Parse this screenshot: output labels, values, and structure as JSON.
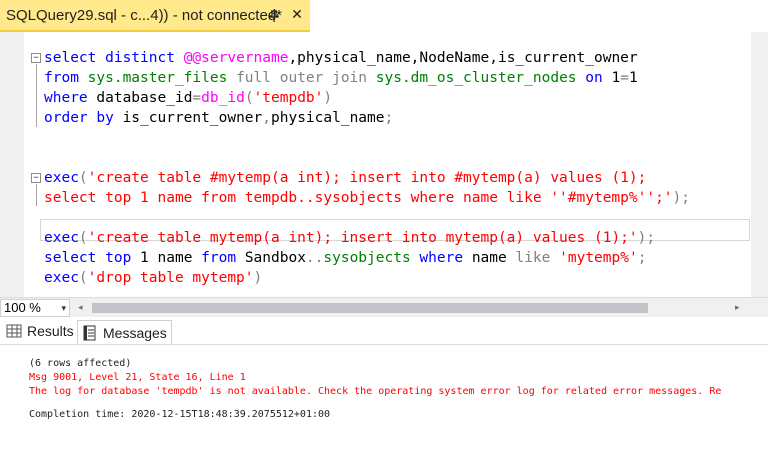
{
  "tab": {
    "title": "SQLQuery29.sql - c...4)) - not connected*",
    "close_glyph": "✕",
    "pin_icon": "pin-icon"
  },
  "editor": {
    "lines": [
      [
        {
          "t": "select distinct ",
          "c": "kw"
        },
        {
          "t": "@@servername",
          "c": "fn"
        },
        {
          "t": ",physical_name,NodeName,is_current_owner",
          "c": ""
        }
      ],
      [
        {
          "t": "from ",
          "c": "kw"
        },
        {
          "t": "sys.master_files ",
          "c": "sys"
        },
        {
          "t": "full outer join ",
          "c": "gry"
        },
        {
          "t": "sys.dm_os_cluster_nodes ",
          "c": "sys"
        },
        {
          "t": "on ",
          "c": "kw"
        },
        {
          "t": "1",
          "c": ""
        },
        {
          "t": "=",
          "c": "gry"
        },
        {
          "t": "1",
          "c": ""
        }
      ],
      [
        {
          "t": "where ",
          "c": "kw"
        },
        {
          "t": "database_id",
          "c": ""
        },
        {
          "t": "=",
          "c": "gry"
        },
        {
          "t": "db_id",
          "c": "fn"
        },
        {
          "t": "(",
          "c": "gry"
        },
        {
          "t": "'tempdb'",
          "c": "str"
        },
        {
          "t": ")",
          "c": "gry"
        }
      ],
      [
        {
          "t": "order by ",
          "c": "kw"
        },
        {
          "t": "is_current_owner",
          "c": ""
        },
        {
          "t": ",",
          "c": "gry"
        },
        {
          "t": "physical_name",
          "c": ""
        },
        {
          "t": ";",
          "c": "gry"
        }
      ],
      [],
      [],
      [
        {
          "t": "exec",
          "c": "kw"
        },
        {
          "t": "(",
          "c": "gry"
        },
        {
          "t": "'create table #mytemp(a int); insert into #mytemp(a) values (1);",
          "c": "str"
        }
      ],
      [
        {
          "t": "select top 1 name from tempdb..sysobjects where name like ''#mytemp%'';'",
          "c": "str"
        },
        {
          "t": ");",
          "c": "gry"
        }
      ],
      [],
      [
        {
          "t": "exec",
          "c": "kw"
        },
        {
          "t": "(",
          "c": "gry"
        },
        {
          "t": "'create table mytemp(a int); insert into mytemp(a) values (1);'",
          "c": "str"
        },
        {
          "t": ");",
          "c": "gry"
        }
      ],
      [
        {
          "t": "select top ",
          "c": "kw"
        },
        {
          "t": "1 ",
          "c": ""
        },
        {
          "t": "name ",
          "c": ""
        },
        {
          "t": "from ",
          "c": "kw"
        },
        {
          "t": "Sandbox",
          "c": ""
        },
        {
          "t": "..",
          "c": "gry"
        },
        {
          "t": "sysobjects ",
          "c": "sys"
        },
        {
          "t": "where ",
          "c": "kw"
        },
        {
          "t": "name ",
          "c": ""
        },
        {
          "t": "like ",
          "c": "gry"
        },
        {
          "t": "'mytemp%'",
          "c": "str"
        },
        {
          "t": ";",
          "c": "gry"
        }
      ],
      [
        {
          "t": "exec",
          "c": "kw"
        },
        {
          "t": "(",
          "c": "gry"
        },
        {
          "t": "'drop table mytemp'",
          "c": "str"
        },
        {
          "t": ")",
          "c": "gry"
        }
      ]
    ]
  },
  "zoom": {
    "value": "100 %",
    "arrow": "▾"
  },
  "scroll": {
    "left_arrow": "◂",
    "right_arrow": "▸"
  },
  "result_tabs": {
    "results": "Results",
    "messages": "Messages"
  },
  "messages": {
    "lines": [
      {
        "text": "(6 rows affected)",
        "error": false
      },
      {
        "text": "Msg 9001, Level 21, State 16, Line 1",
        "error": true
      },
      {
        "text": "The log for database 'tempdb' is not available. Check the operating system error log for related error messages. Re",
        "error": true
      },
      {
        "text": "",
        "error": false
      },
      {
        "text": "Completion time: 2020-12-15T18:48:39.2075512+01:00",
        "error": false
      }
    ]
  },
  "colors": {
    "tab_active": "#ffe98a",
    "keyword": "#0000ff",
    "function": "#ff00ff",
    "string": "#ff0000",
    "operator": "#808080",
    "system_object": "#008000",
    "error": "#ff0000"
  }
}
